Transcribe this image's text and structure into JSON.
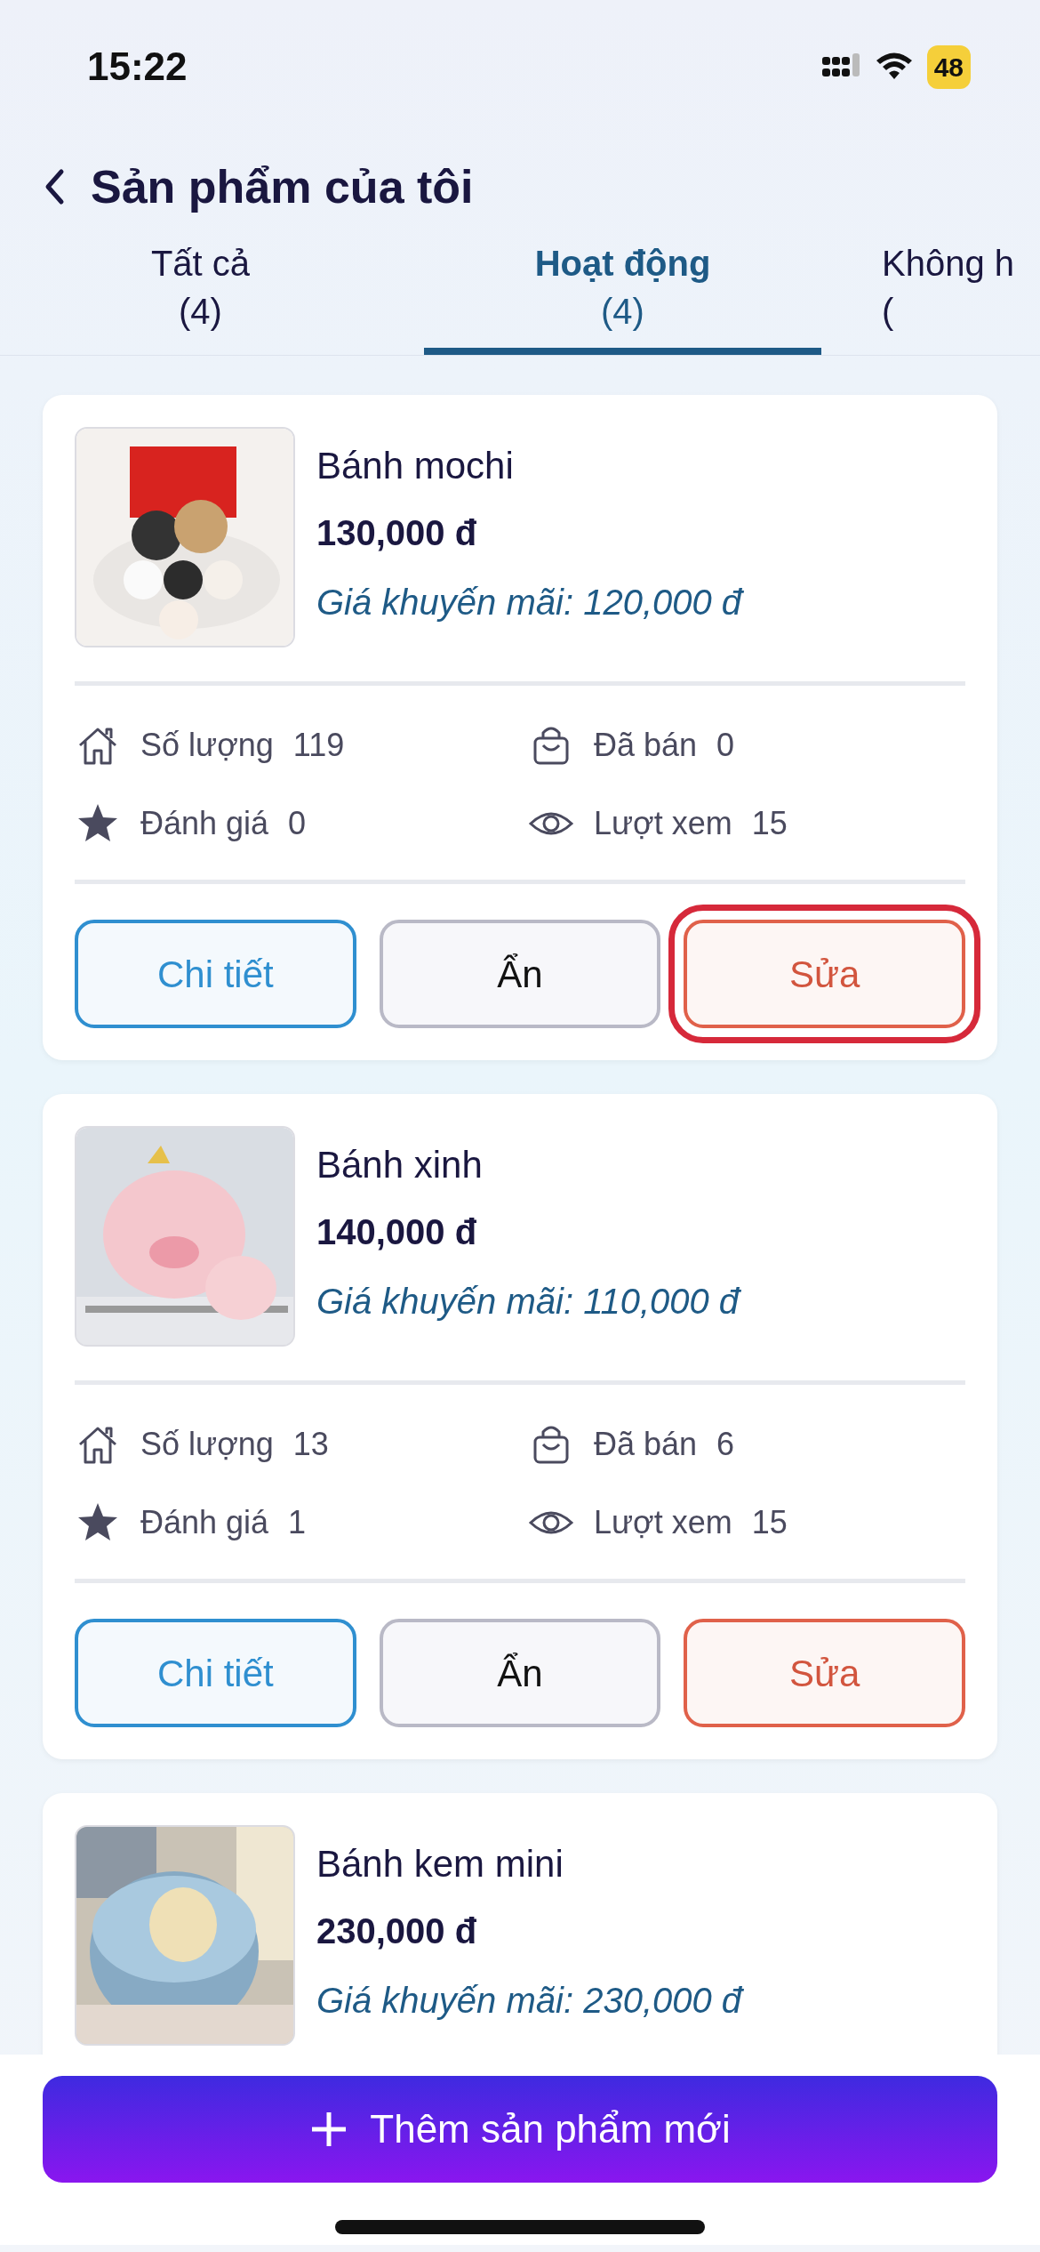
{
  "status_bar": {
    "time": "15:22",
    "battery": "48"
  },
  "header": {
    "title": "Sản phẩm của tôi"
  },
  "tabs": [
    {
      "label": "Tất cả",
      "count": "(4)",
      "selected": false
    },
    {
      "label": "Hoạt động",
      "count": "(4)",
      "selected": true
    },
    {
      "label": "Không h",
      "count": "(",
      "selected": false
    }
  ],
  "products": [
    {
      "name": "Bánh mochi",
      "price": "130,000 đ",
      "promo": "Giá khuyến mãi: 120,000 đ",
      "stats": [
        {
          "kind": "stock",
          "label": "Số lượng",
          "value": "119"
        },
        {
          "kind": "sold",
          "label": "Đã bán",
          "value": "0"
        },
        {
          "kind": "rating",
          "label": "Đánh giá",
          "value": "0"
        },
        {
          "kind": "views",
          "label": "Lượt xem",
          "value": "15"
        }
      ],
      "buttons": [
        {
          "kind": "detail",
          "label": "Chi tiết"
        },
        {
          "kind": "hide",
          "label": "Ẩn"
        },
        {
          "kind": "edit",
          "label": "Sửa",
          "highlighted": true
        }
      ]
    },
    {
      "name": "Bánh xinh",
      "price": "140,000 đ",
      "promo": "Giá khuyến mãi: 110,000 đ",
      "stats": [
        {
          "kind": "stock",
          "label": "Số lượng",
          "value": "13"
        },
        {
          "kind": "sold",
          "label": "Đã bán",
          "value": "6"
        },
        {
          "kind": "rating",
          "label": "Đánh giá",
          "value": "1"
        },
        {
          "kind": "views",
          "label": "Lượt xem",
          "value": "15"
        }
      ],
      "buttons": [
        {
          "kind": "detail",
          "label": "Chi tiết"
        },
        {
          "kind": "hide",
          "label": "Ẩn"
        },
        {
          "kind": "edit",
          "label": "Sửa",
          "highlighted": false
        }
      ]
    },
    {
      "name": "Bánh kem mini",
      "price": "230,000 đ",
      "promo": "Giá khuyến mãi: 230,000 đ"
    }
  ],
  "add_button": {
    "label": "Thêm sản phẩm mới"
  }
}
